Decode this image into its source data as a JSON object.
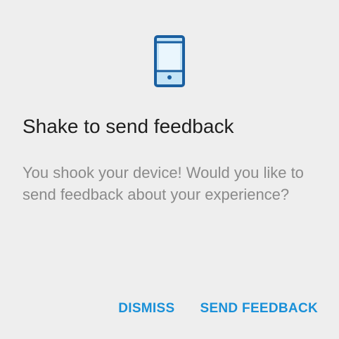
{
  "dialog": {
    "icon": "phone-icon",
    "title": "Shake to send feedback",
    "message": "You shook your device! Would you like to send feedback about your experience?",
    "buttons": {
      "dismiss": "DISMISS",
      "send_feedback": "SEND FEEDBACK"
    }
  },
  "colors": {
    "background": "#eeeeee",
    "title_text": "#1e1e1e",
    "message_text": "#8a8a8a",
    "accent": "#1a90d8",
    "icon_primary": "#1a5fa0",
    "icon_fill": "#c4e4f7",
    "icon_screen": "#eaf6fd"
  }
}
